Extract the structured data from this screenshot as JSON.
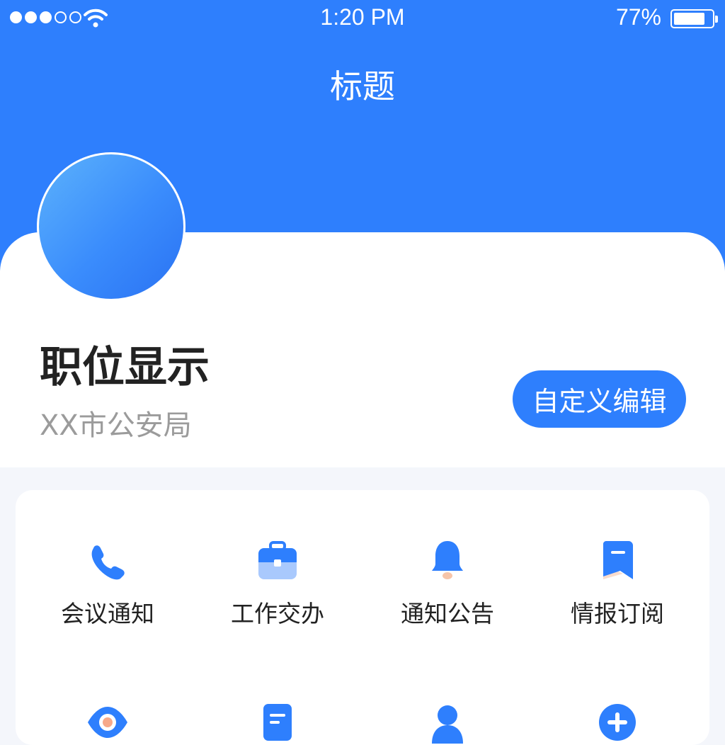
{
  "status_bar": {
    "time": "1:20 PM",
    "battery": "77%",
    "battery_level": 0.77
  },
  "header": {
    "title": "标题"
  },
  "profile": {
    "position": "职位显示",
    "organization": "XX市公安局",
    "edit_button": "自定义编辑"
  },
  "grid": {
    "items": [
      {
        "label": "会议通知",
        "icon": "phone-icon"
      },
      {
        "label": "工作交办",
        "icon": "briefcase-icon"
      },
      {
        "label": "通知公告",
        "icon": "bell-icon"
      },
      {
        "label": "情报订阅",
        "icon": "bookmark-icon"
      },
      {
        "label": "",
        "icon": "eye-icon"
      },
      {
        "label": "",
        "icon": "document-icon"
      },
      {
        "label": "",
        "icon": "user-icon"
      },
      {
        "label": "",
        "icon": "add-icon"
      }
    ]
  },
  "colors": {
    "primary": "#2e7ffd",
    "light_primary": "#a9c9fd",
    "background": "#f4f6fb",
    "accent": "#f7c5a9"
  }
}
